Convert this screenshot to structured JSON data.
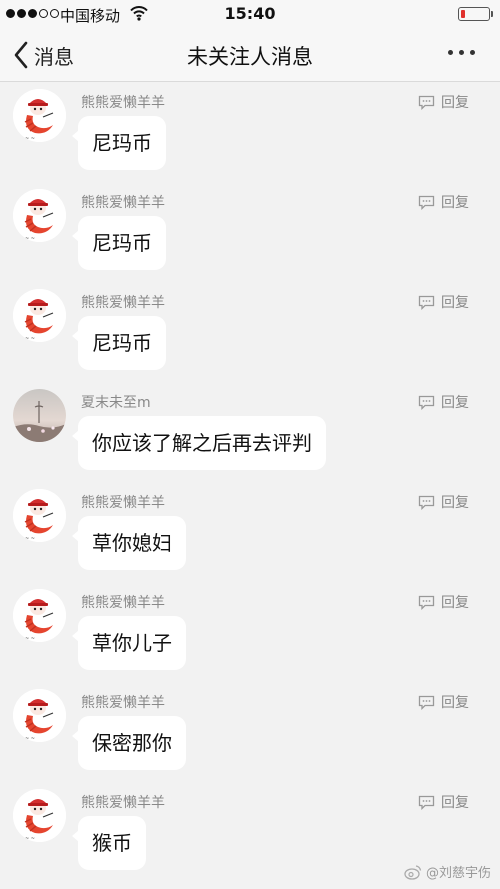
{
  "status_bar": {
    "carrier": "中国移动",
    "time": "15:40",
    "signal_filled": 3,
    "signal_total": 5,
    "battery_level": 0.15,
    "battery_color": "#e0312d",
    "icons": [
      "wifi-icon",
      "battery-icon"
    ]
  },
  "nav": {
    "back_label": "消息",
    "title": "未关注人消息",
    "back_icon": "chevron-left-icon",
    "more_icon": "ellipsis-icon"
  },
  "reply_label": "回复",
  "messages": [
    {
      "avatar": "shrimp",
      "username": "熊熊爱懒羊羊",
      "text": "尼玛币"
    },
    {
      "avatar": "shrimp",
      "username": "熊熊爱懒羊羊",
      "text": "尼玛币"
    },
    {
      "avatar": "shrimp",
      "username": "熊熊爱懒羊羊",
      "text": "尼玛币"
    },
    {
      "avatar": "landscape",
      "username": "夏末未至m",
      "text": "你应该了解之后再去评判"
    },
    {
      "avatar": "shrimp",
      "username": "熊熊爱懒羊羊",
      "text": "草你媳妇"
    },
    {
      "avatar": "shrimp",
      "username": "熊熊爱懒羊羊",
      "text": "草你儿子"
    },
    {
      "avatar": "shrimp",
      "username": "熊熊爱懒羊羊",
      "text": "保密那你"
    },
    {
      "avatar": "shrimp",
      "username": "熊熊爱懒羊羊",
      "text": "猴币"
    }
  ],
  "watermark": "@刘慈宇伤"
}
